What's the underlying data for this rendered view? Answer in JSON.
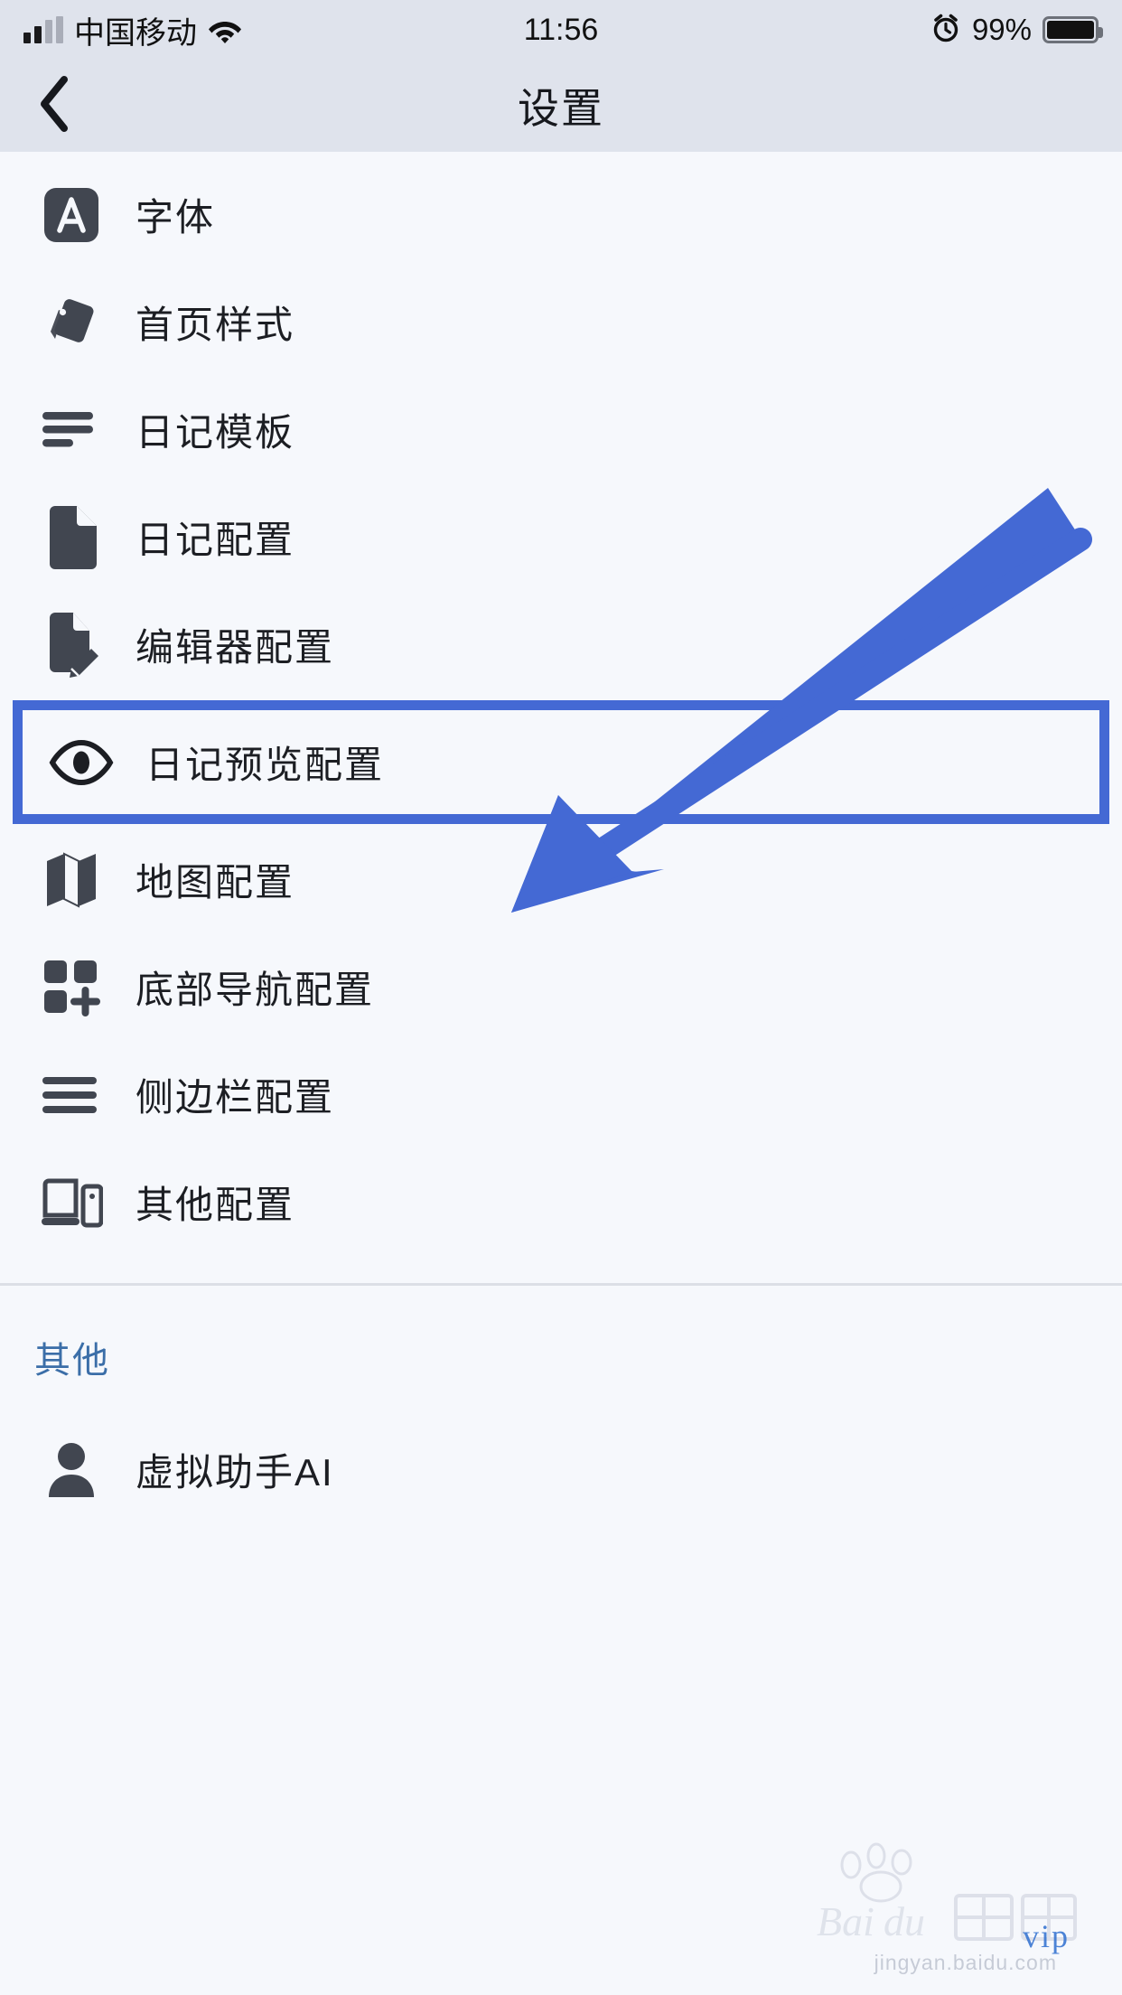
{
  "status_bar": {
    "carrier": "中国移动",
    "time": "11:56",
    "battery_percent": "99%",
    "signal_icon": "signal-bars-icon",
    "wifi_icon": "wifi-icon",
    "alarm_icon": "alarm-clock-icon",
    "battery_icon": "battery-full-icon"
  },
  "nav": {
    "title": "设置",
    "back_icon": "chevron-left-icon"
  },
  "settings": {
    "items": [
      {
        "label": "字体",
        "icon": "letter-a-square-icon"
      },
      {
        "label": "首页样式",
        "icon": "theme-cards-icon"
      },
      {
        "label": "日记模板",
        "icon": "text-lines-icon"
      },
      {
        "label": "日记配置",
        "icon": "document-icon"
      },
      {
        "label": "编辑器配置",
        "icon": "document-pencil-icon"
      },
      {
        "label": "日记预览配置",
        "icon": "eye-icon",
        "highlighted": true
      },
      {
        "label": "地图配置",
        "icon": "map-icon"
      },
      {
        "label": "底部导航配置",
        "icon": "grid-plus-icon"
      },
      {
        "label": "侧边栏配置",
        "icon": "hamburger-lines-icon"
      },
      {
        "label": "其他配置",
        "icon": "laptop-phone-icon"
      }
    ]
  },
  "other_section": {
    "header": "其他",
    "items": [
      {
        "label": "虚拟助手AI",
        "icon": "person-icon"
      }
    ]
  },
  "annotation": {
    "color": "#4469d4",
    "arrow_icon": "arrow-pointing-down-left-icon",
    "highlight_box_icon": "highlight-rectangle-icon"
  },
  "watermark": {
    "brand": "Baidu 经验",
    "url": "jingyan.baidu.com",
    "tier": "vip"
  },
  "colors": {
    "accent": "#4469d4",
    "status_bar_bg": "#dfe3ec",
    "page_bg": "#f6f8fc",
    "icon": "#414650",
    "section_header": "#3b6ea8"
  }
}
